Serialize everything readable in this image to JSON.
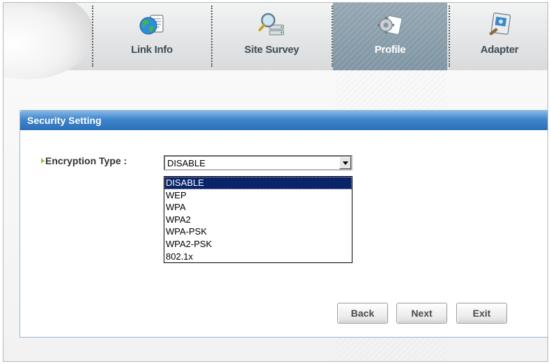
{
  "nav": {
    "tabs": [
      {
        "label": "Link Info",
        "icon": "globe-document-icon"
      },
      {
        "label": "Site Survey",
        "icon": "magnifier-network-icon"
      },
      {
        "label": "Profile",
        "icon": "gear-profile-icon",
        "active": true
      },
      {
        "label": "Adapter",
        "icon": "adapter-monitor-icon"
      }
    ]
  },
  "panel": {
    "title": "Security Setting",
    "encryption_label": "Encryption Type :",
    "encryption_value": "DISABLE",
    "encryption_options": [
      "DISABLE",
      "WEP",
      "WPA",
      "WPA2",
      "WPA-PSK",
      "WPA2-PSK",
      "802.1x"
    ]
  },
  "buttons": {
    "back": "Back",
    "next": "Next",
    "exit": "Exit"
  },
  "colors": {
    "header_blue": "#2c6fb8",
    "active_tab": "#8a9eac",
    "selection": "#0a246a",
    "bullet_green": "#8dc63f"
  }
}
